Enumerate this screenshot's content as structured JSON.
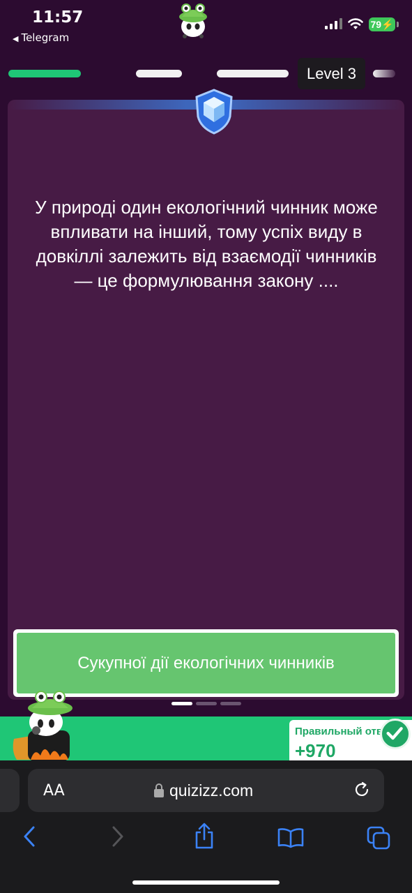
{
  "status_bar": {
    "time": "11:57",
    "back_label": "Telegram",
    "battery": "79"
  },
  "progress": {
    "level_label": "Level 3"
  },
  "question": {
    "text": "У природі один екологічний чинник може впливати на інший, тому успіх виду в довкіллі залежить від взаємодії чинників — це формулювання закону ...."
  },
  "answer": {
    "text": "Сукупної дії екологічних чинників"
  },
  "banner": {
    "score_label": "Правильный ответ",
    "score_points": "+970"
  },
  "browser": {
    "text_size_label": "AA",
    "url": "quizizz.com"
  },
  "colors": {
    "background": "#2c0b30",
    "card": "#471b45",
    "correct_green": "#66c56f",
    "progress_green": "#1fc676",
    "banner_green": "#1fc676"
  }
}
